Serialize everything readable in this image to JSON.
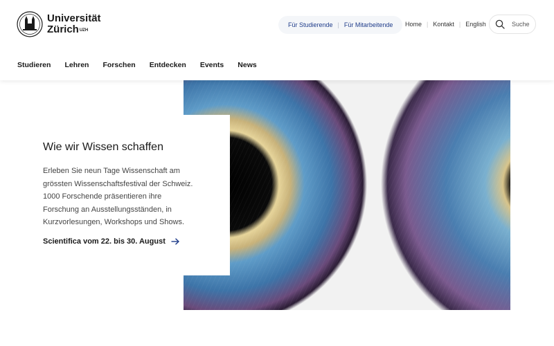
{
  "brand": {
    "name_line1": "Universität",
    "name_line2": "Zürich",
    "suffix": "UZH"
  },
  "audience_links": [
    "Für Studierende",
    "Für Mitarbeitende"
  ],
  "meta_links": [
    "Home",
    "Kontakt",
    "English"
  ],
  "search": {
    "label": "Suche",
    "icon": "search-icon"
  },
  "nav": [
    "Studieren",
    "Lehren",
    "Forschen",
    "Entdecken",
    "Events",
    "News"
  ],
  "hero": {
    "title": "Wie wir Wissen schaffen",
    "text": "Erleben Sie neun Tage Wissenschaft am grössten Wissenschaftsfestival der Schweiz. 1000 Forschende präsentieren ihre Forschung an Ausstellungsständen, in Kurzvorlesungen, Workshops und Shows.",
    "link": "Scientifica vom 22. bis 30. August",
    "link_icon": "arrow-right-icon"
  },
  "colors": {
    "accent": "#1f3c8a",
    "pill_bg": "#f4f6f9",
    "iris_blue": "#4a86b8",
    "iris_gold": "#d8c48a"
  }
}
